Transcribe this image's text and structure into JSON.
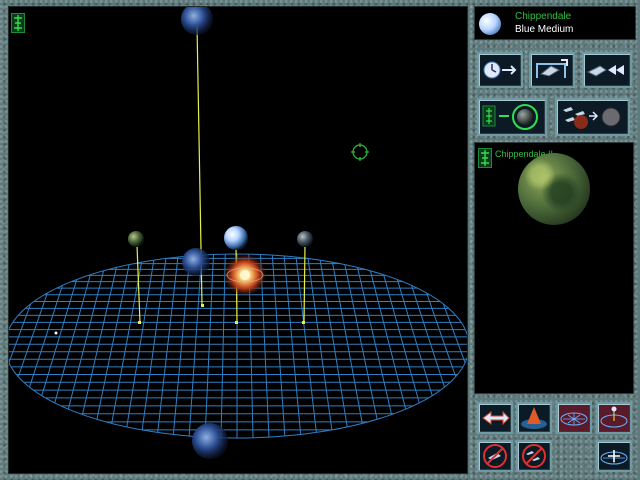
{
  "star": {
    "name": "Chippendale",
    "class": "Blue Medium",
    "color": "#b8d6ff"
  },
  "selected_planet": {
    "name": "Chippendale II"
  },
  "colors": {
    "grid": "#2f7fc4",
    "stalk": "#e6f04a",
    "accent_green": "#2fbf3f",
    "frame": "#5f7a7c"
  },
  "icons": {
    "view_top_left": "colony-emblem-icon",
    "panel_emblem": "colony-emblem-icon",
    "target_cursor": "target-reticle-icon"
  },
  "commands": [
    {
      "id": "time-forward",
      "icon": "clock-arrow-icon"
    },
    {
      "id": "launch-ship",
      "icon": "ship-launch-icon"
    },
    {
      "id": "fleet-move",
      "icon": "ship-fast-forward-icon"
    },
    {
      "id": "colony-planet",
      "icon": "colony-to-planet-icon"
    },
    {
      "id": "fleet-attack",
      "icon": "fleet-vs-planet-icon"
    }
  ],
  "view_controls": [
    {
      "id": "rotate-left-right",
      "icon": "rotate-arrows-icon"
    },
    {
      "id": "tilt",
      "icon": "tilt-pyramid-icon"
    },
    {
      "id": "grid-toggle",
      "icon": "grid-disc-icon"
    },
    {
      "id": "orbit-view",
      "icon": "orbit-disc-icon"
    },
    {
      "id": "no-ships",
      "icon": "ship-forbidden-icon"
    },
    {
      "id": "no-fleet",
      "icon": "fleet-forbidden-icon"
    },
    {
      "id": "zoom-grid",
      "icon": "grid-zoom-icon"
    }
  ]
}
